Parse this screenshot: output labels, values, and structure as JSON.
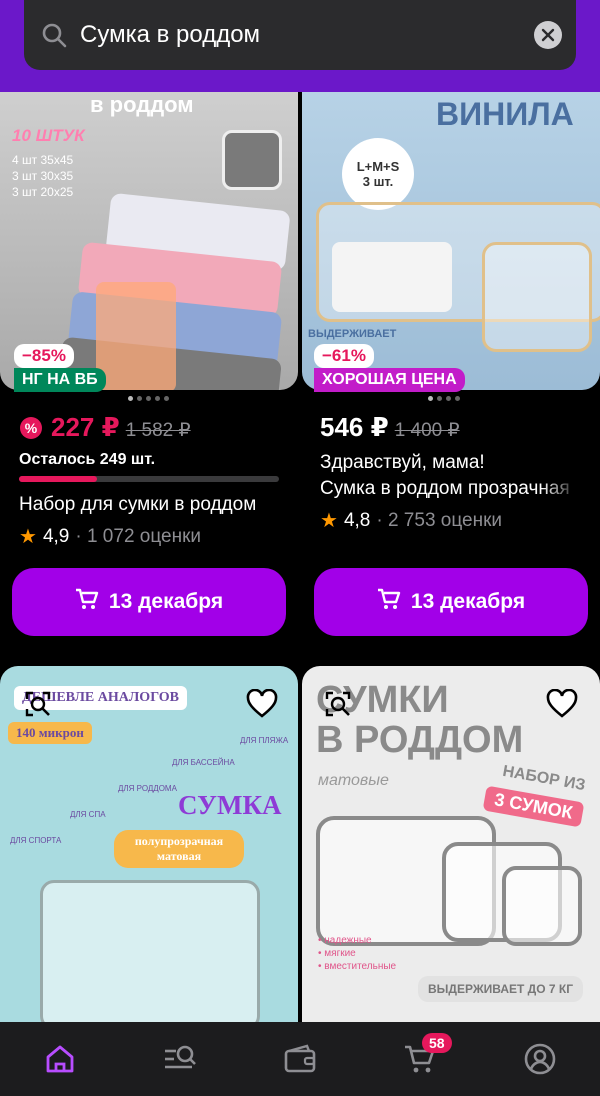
{
  "search": {
    "value": "Сумка в роддом"
  },
  "products": [
    {
      "discount": "−85%",
      "tag": "НГ НА ВБ",
      "price": "227 ₽",
      "old_price": "1 582 ₽",
      "stock": "Осталось 249 шт.",
      "title": "Набор для сумки в роддом",
      "rating": "4,9",
      "reviews": "· 1 072 оценки",
      "button": "13 декабря",
      "image_text": {
        "top": "в роддом",
        "count": "10 ШТУК",
        "sizes": [
          "4 шт 35х45",
          "3 шт 30х35",
          "3 шт 20х25"
        ]
      }
    },
    {
      "discount": "−61%",
      "tag": "ХОРОШАЯ ЦЕНА",
      "price": "546 ₽",
      "old_price": "1 400 ₽",
      "title_line1": "Здравствуй, мама!",
      "title_line2": "Сумка в роддом прозрачная",
      "rating": "4,8",
      "reviews": "· 2 753 оценки",
      "button": "13 декабря",
      "image_text": {
        "top": "ВИНИЛА",
        "set": "L+M+S",
        "pcs": "3 шт.",
        "hold": "ВЫДЕРЖИВАЕТ"
      }
    },
    {
      "image_text": {
        "top": "ДЕШЕВЛЕ АНАЛОГОВ",
        "mic": "140 микрон",
        "uses": [
          "ДЛЯ ПЛЯЖА",
          "ДЛЯ БАССЕЙНА",
          "ДЛЯ РОДДОМА",
          "ДЛЯ СПА",
          "ДЛЯ СПОРТА"
        ],
        "big": "СУМКА",
        "sub": "полупрозрачная матовая"
      }
    },
    {
      "image_text": {
        "title1": "СУМКИ",
        "title2": "В РОДДОМ",
        "matte": "матовые",
        "set1": "НАБОР ИЗ",
        "set2": "3 СУМОК",
        "feats": [
          "• надежные",
          "• мягкие",
          "• вместительные"
        ],
        "hold": "ВЫДЕРЖИВАЕТ ДО 7 КГ"
      }
    }
  ],
  "nav": {
    "cart_count": "58"
  },
  "colors": {
    "accent": "#a200e8",
    "header": "#6b18c9",
    "sale": "#e6185c",
    "tag_green": "#00875a",
    "tag_purple": "#c21cc9"
  }
}
